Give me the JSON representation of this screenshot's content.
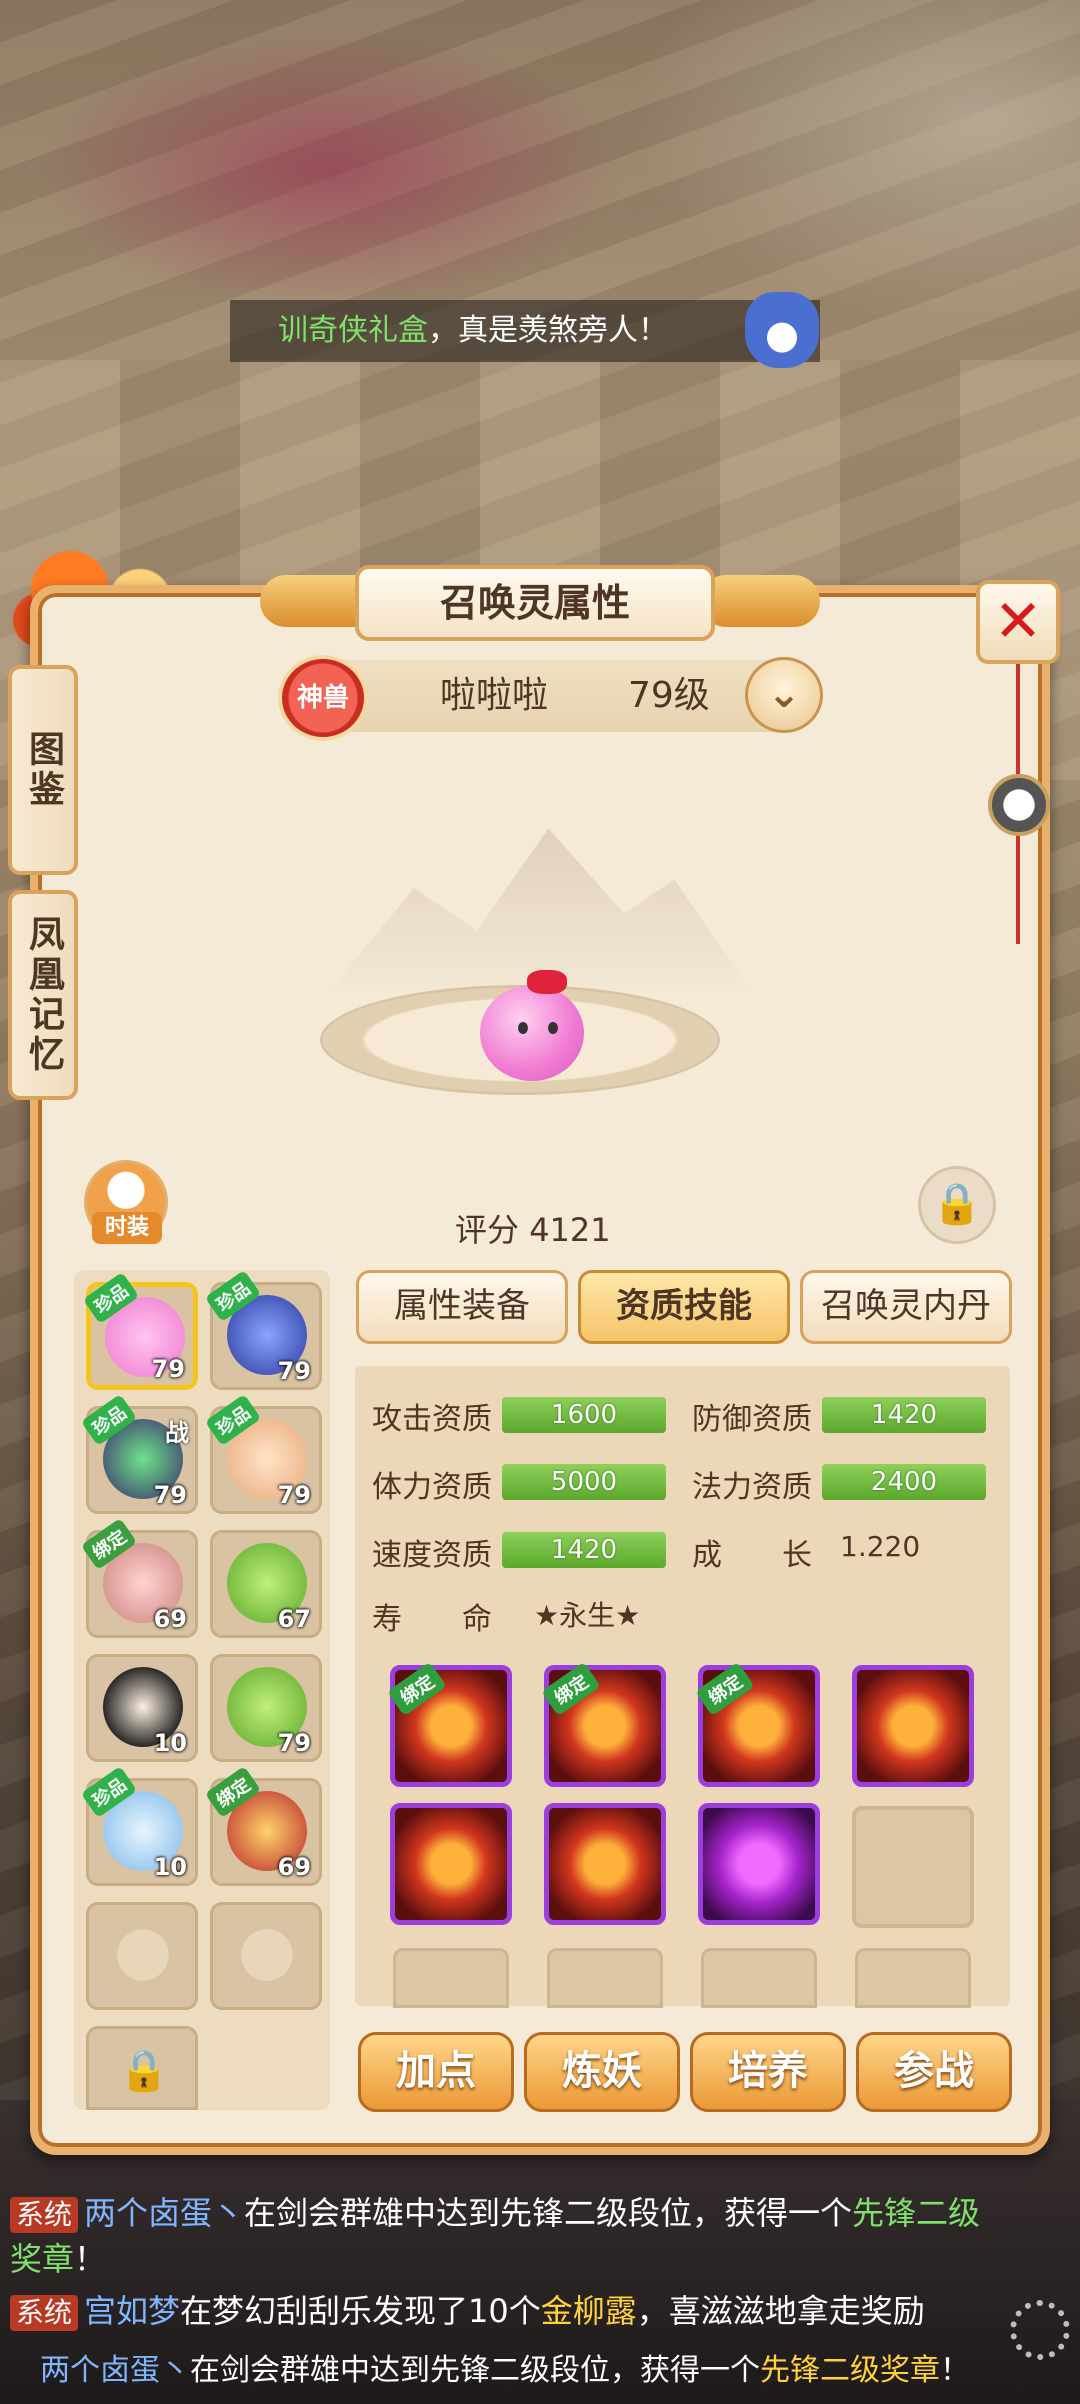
{
  "broadcast": {
    "highlight": "训奇侠礼盒",
    "text": "，真是羡煞旁人！"
  },
  "panel": {
    "title": "召唤灵属性",
    "close": "✕",
    "side_tabs": [
      "图鉴",
      "凤凰记忆"
    ]
  },
  "pet": {
    "badge": "神兽",
    "name": "啦啦啦",
    "level": "79级",
    "score_label": "评分",
    "score_value": "4121"
  },
  "fashion_label": "时装",
  "tabs": [
    "属性装备",
    "资质技能",
    "召唤灵内丹"
  ],
  "active_tab": 1,
  "stats": {
    "attack_label": "攻击资质",
    "attack": "1600",
    "defense_label": "防御资质",
    "defense": "1420",
    "hp_label": "体力资质",
    "hp": "5000",
    "mp_label": "法力资质",
    "mp": "2400",
    "speed_label": "速度资质",
    "speed": "1420",
    "growth_label": "成　　长",
    "growth": "1.220",
    "life_label": "寿　　命",
    "life": "★永生★"
  },
  "pet_list": [
    {
      "level": "79",
      "tag": "珍品"
    },
    {
      "level": "79",
      "tag": "珍品"
    },
    {
      "level": "79",
      "tag": "珍品",
      "extra": "战"
    },
    {
      "level": "79",
      "tag": "珍品"
    },
    {
      "level": "69",
      "tag": "绑定"
    },
    {
      "level": "67",
      "tag": ""
    },
    {
      "level": "10",
      "tag": ""
    },
    {
      "level": "79",
      "tag": ""
    },
    {
      "level": "10",
      "tag": "珍品"
    },
    {
      "level": "69",
      "tag": "绑定"
    }
  ],
  "skill_tags": [
    "绑定",
    "绑定",
    "绑定"
  ],
  "actions": [
    "加点",
    "炼妖",
    "培养",
    "参战"
  ],
  "chat": {
    "sys": "系统",
    "line1_name": "两个卤蛋丶",
    "line1_text": "在剑会群雄中达到先锋二级段位，获得一个",
    "line1_item": "先锋二级奖章",
    "line1_end": "！",
    "line2_name": "宫如梦",
    "line2_text1": "在梦幻刮刮乐发现了10个",
    "line2_item": "金柳露",
    "line2_text2": "，喜滋滋地拿走奖励",
    "line3_name": "两个卤蛋丶",
    "line3_text": "在剑会群雄中达到先锋二级段位，获得一个",
    "line3_item": "先锋二级奖章",
    "line3_end": "！"
  }
}
